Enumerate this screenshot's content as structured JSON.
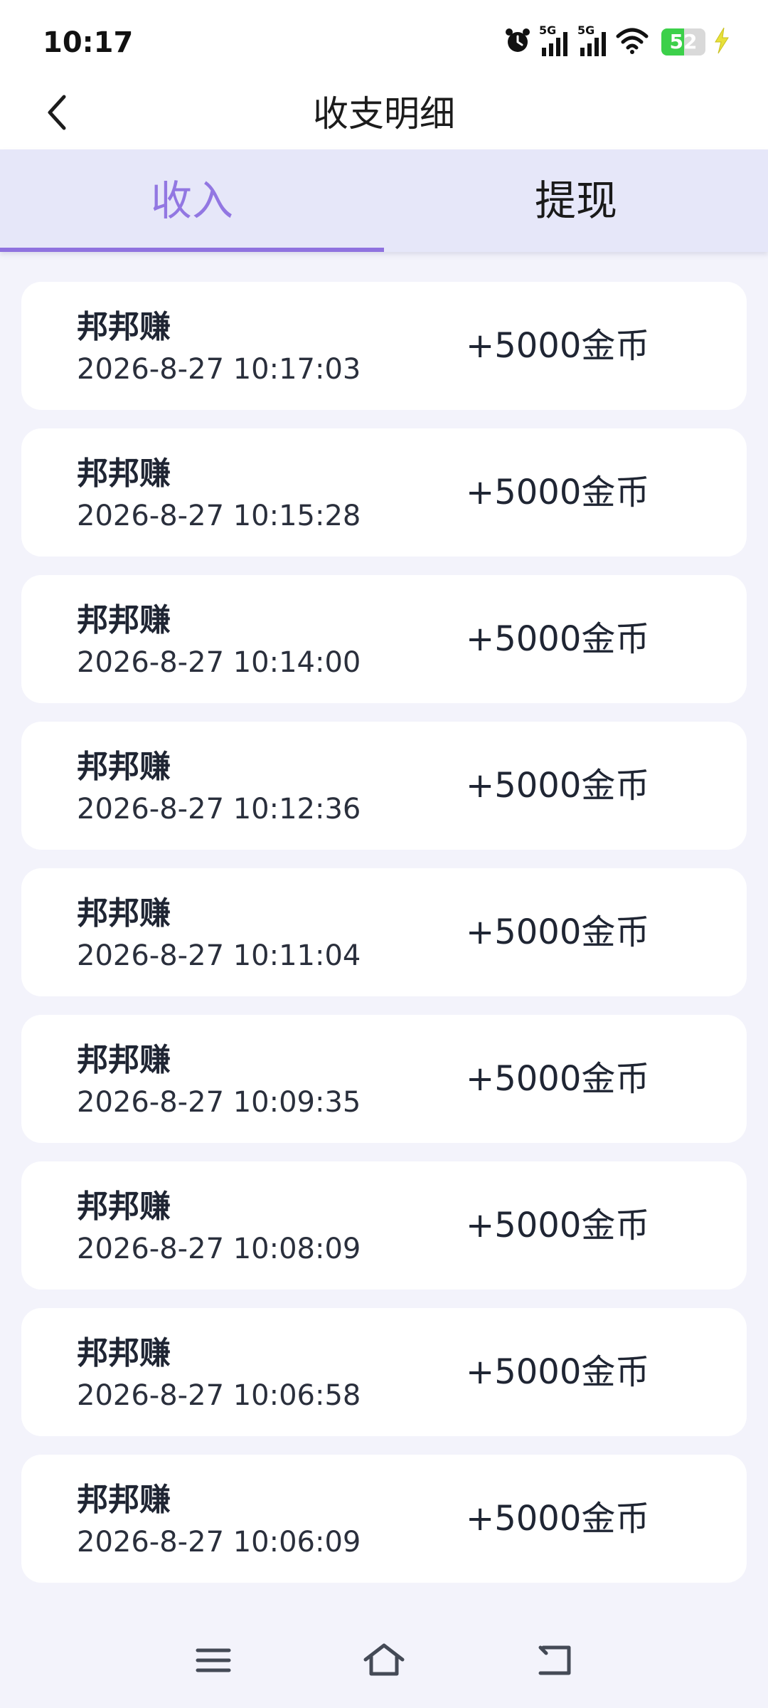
{
  "status_bar": {
    "time": "10:17",
    "battery_level": "52",
    "battery_fraction": 0.52,
    "icons": [
      "alarm-icon",
      "signal-5g-icon",
      "signal-5g-icon",
      "wifi-icon",
      "battery-icon",
      "charging-bolt-icon"
    ],
    "net_label_1": "5G",
    "net_label_2": "5G"
  },
  "header": {
    "title": "收支明细",
    "back_icon": "chevron-left-icon"
  },
  "tabs": [
    {
      "label": "收入",
      "active": true
    },
    {
      "label": "提现",
      "active": false
    }
  ],
  "records": [
    {
      "name": "邦邦赚",
      "time": "2026-8-27 10:17:03",
      "amount": "+5000金币"
    },
    {
      "name": "邦邦赚",
      "time": "2026-8-27 10:15:28",
      "amount": "+5000金币"
    },
    {
      "name": "邦邦赚",
      "time": "2026-8-27 10:14:00",
      "amount": "+5000金币"
    },
    {
      "name": "邦邦赚",
      "time": "2026-8-27 10:12:36",
      "amount": "+5000金币"
    },
    {
      "name": "邦邦赚",
      "time": "2026-8-27 10:11:04",
      "amount": "+5000金币"
    },
    {
      "name": "邦邦赚",
      "time": "2026-8-27 10:09:35",
      "amount": "+5000金币"
    },
    {
      "name": "邦邦赚",
      "time": "2026-8-27 10:08:09",
      "amount": "+5000金币"
    },
    {
      "name": "邦邦赚",
      "time": "2026-8-27 10:06:58",
      "amount": "+5000金币"
    },
    {
      "name": "邦邦赚",
      "time": "2026-8-27 10:06:09",
      "amount": "+5000金币"
    }
  ],
  "nav_bar": {
    "icons": [
      "menu-icon",
      "home-icon",
      "back-icon"
    ]
  },
  "colors": {
    "accent": "#8f72df",
    "tab_bar_bg": "#e6e7f9",
    "page_bg": "#f3f3fb",
    "battery_green": "#3cd04a"
  }
}
